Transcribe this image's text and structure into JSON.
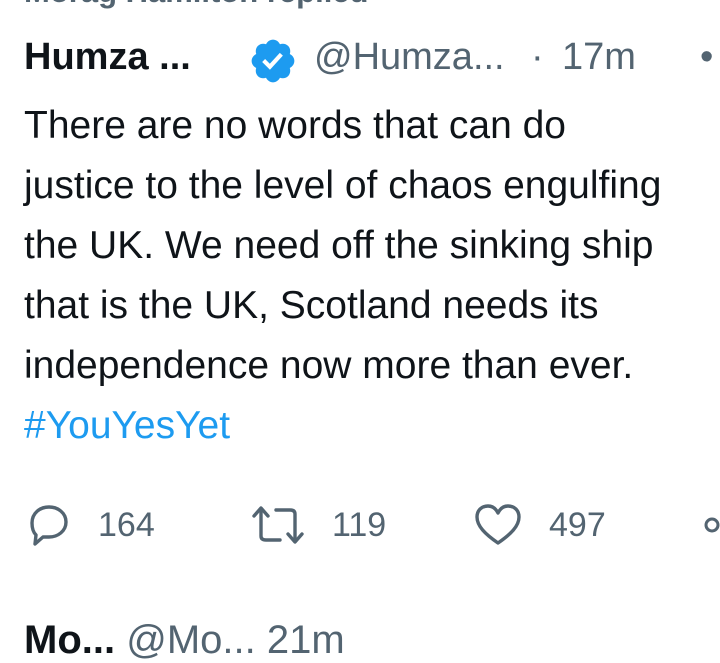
{
  "previous_tweet": {
    "replied_text": "Morag Hamilton replied"
  },
  "tweet": {
    "author_name": "Humza ...",
    "handle": "@Humza...",
    "separator": "·",
    "time": "17m",
    "more": "•",
    "verified_icon": "verified-badge-icon",
    "text_lines": [
      "There are no words that can do",
      "justice to the level of chaos engulfing",
      "the UK. We need off the sinking ship",
      "that is the UK, Scotland needs its",
      "independence now more than ever."
    ],
    "hashtag": "#YouYesYet",
    "colors": {
      "hashtag": "#1d9bf0",
      "verified": "#1d9bf0",
      "muted": "#536471",
      "text": "#0f1419"
    }
  },
  "actions": {
    "reply": {
      "icon": "reply-bubble-icon",
      "count": "164"
    },
    "retweet": {
      "icon": "retweet-icon",
      "count": "119"
    },
    "like": {
      "icon": "heart-icon",
      "count": "497"
    },
    "share": {
      "icon": "share-icon"
    }
  },
  "next_tweet": {
    "author_name": "Mo...",
    "handle": "@Mo...",
    "time": "21m"
  }
}
